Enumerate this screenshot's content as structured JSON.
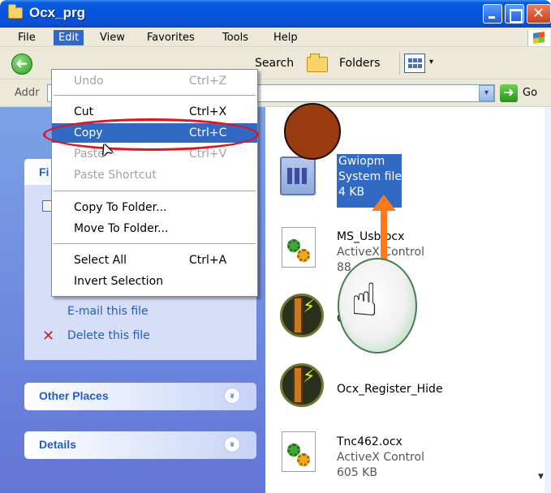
{
  "window": {
    "title": "Ocx_prg",
    "minimize_glyph": "",
    "maximize_glyph": "",
    "close_glyph": "✕"
  },
  "menubar": {
    "items": [
      {
        "label": "File"
      },
      {
        "label": "Edit"
      },
      {
        "label": "View"
      },
      {
        "label": "Favorites"
      },
      {
        "label": "Tools"
      },
      {
        "label": "Help"
      }
    ]
  },
  "toolbar": {
    "back_glyph": "➜",
    "search_label": "Search",
    "folders_label": "Folders",
    "views_dropdown_glyph": "▾"
  },
  "addressbar": {
    "label": "Addr",
    "dropdown_glyph": "▾",
    "go_glyph": "➜",
    "go_label": "Go"
  },
  "edit_menu": {
    "items": [
      {
        "label": "Undo",
        "shortcut": "Ctrl+Z",
        "state": "disabled"
      },
      {
        "label": "Cut",
        "shortcut": "Ctrl+X",
        "state": "enabled"
      },
      {
        "label": "Copy",
        "shortcut": "Ctrl+C",
        "state": "highlighted"
      },
      {
        "label": "Paste",
        "shortcut": "Ctrl+V",
        "state": "disabled"
      },
      {
        "label": "Paste Shortcut",
        "shortcut": "",
        "state": "disabled"
      },
      {
        "label": "Copy To Folder...",
        "shortcut": "",
        "state": "enabled"
      },
      {
        "label": "Move To Folder...",
        "shortcut": "",
        "state": "enabled"
      },
      {
        "label": "Select All",
        "shortcut": "Ctrl+A",
        "state": "enabled"
      },
      {
        "label": "Invert Selection",
        "shortcut": "",
        "state": "enabled"
      }
    ]
  },
  "task_pane": {
    "file_tasks_header": "Fi",
    "links": [
      {
        "label": "E-mail this file",
        "icon": "email-icon"
      },
      {
        "label": "Delete this file",
        "icon": "delete-icon"
      }
    ],
    "other_places": "Other Places",
    "details": "Details",
    "chevron_glyph": "»"
  },
  "files": [
    {
      "name": "Gwiopm",
      "type": "System file",
      "size": "4 KB",
      "selected": true,
      "icon": "system-file-icon"
    },
    {
      "name": "MS_Usb.ocx",
      "type": "ActiveX Control",
      "size": "88",
      "icon": "activex-icon"
    },
    {
      "name": "O",
      "type": "",
      "size": "",
      "icon": "ocx-register-icon"
    },
    {
      "name": "Ocx_Register_Hide",
      "type": "",
      "size": "",
      "icon": "ocx-register-icon"
    },
    {
      "name": "Tnc462.ocx",
      "type": "ActiveX Control",
      "size": "605 KB",
      "icon": "activex-icon"
    }
  ],
  "overlays": {
    "hand_glyph": "☝",
    "cursor_glyph": "➤",
    "scroll_down_glyph": "▼"
  },
  "colors": {
    "accent": "#316ac5",
    "titlebar": "#0553dc",
    "annotation_red": "#e3121b",
    "annotation_orange": "#ff7a1a",
    "annotation_brown": "#9a3a0f"
  }
}
